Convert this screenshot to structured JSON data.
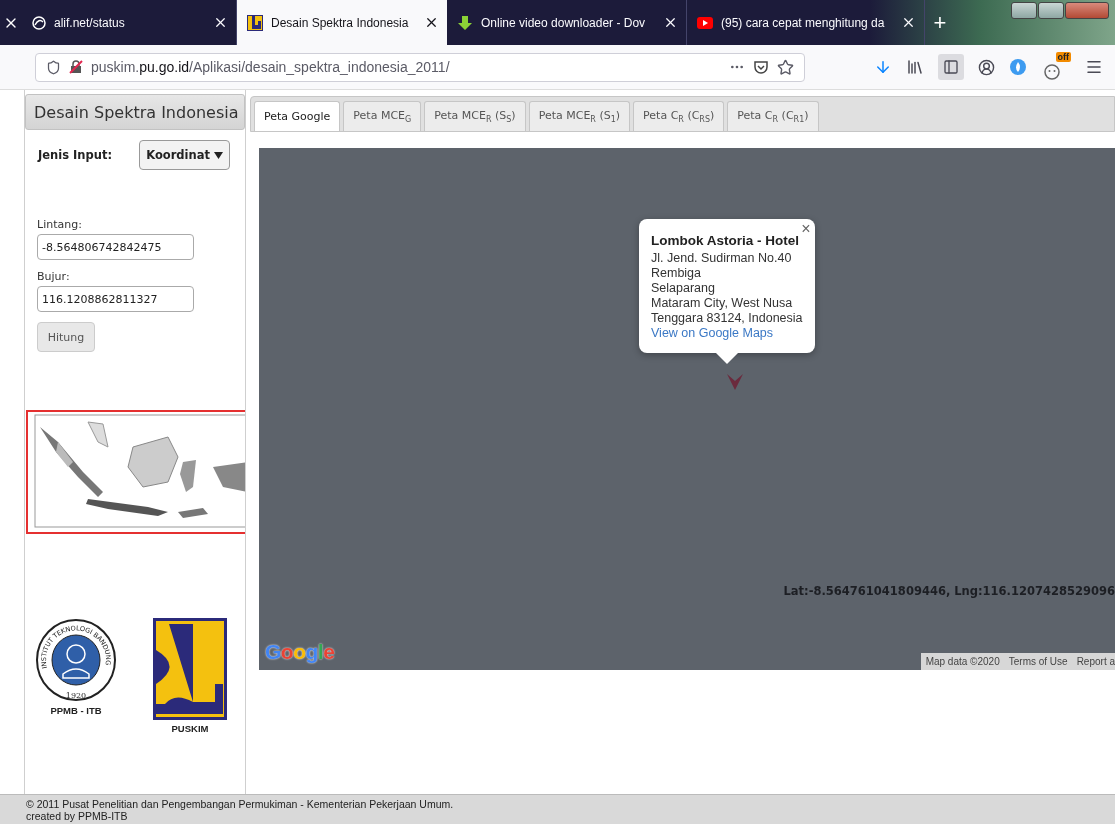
{
  "browser": {
    "tabs": [
      {
        "title": "alif.net/status",
        "kind": "status",
        "selected": false
      },
      {
        "title": "Desain Spektra Indonesia",
        "kind": "puskim",
        "selected": true
      },
      {
        "title": "Online video downloader - Dov",
        "kind": "download",
        "selected": false
      },
      {
        "title": "(95) cara cepat menghitung da",
        "kind": "youtube",
        "selected": false
      }
    ],
    "new_tab": "+",
    "url": "puskim.**pu.go.id**/Aplikasi/desain_spektra_indonesia_2011/",
    "addon_badge": "off"
  },
  "sidebar": {
    "title": "Desain Spektra Indonesia",
    "input_type": {
      "label": "Jenis Input:",
      "value": "Koordinat"
    },
    "fields": [
      {
        "label": "Lintang:",
        "value": "-8.564806742842475"
      },
      {
        "label": "Bujur:",
        "value": "116.1208862811327"
      }
    ],
    "button": "Hitung",
    "logos": [
      {
        "kind": "itb",
        "ring_text": "INSTITUT TEKNOLOGI BANDUNG",
        "year": "1920",
        "caption": "PPMB - ITB"
      },
      {
        "kind": "pu",
        "caption": "PUSKIM"
      }
    ]
  },
  "tabs": [
    {
      "label": "Peta Google",
      "selected": true
    },
    {
      "label": "Peta MCE$_{G}$",
      "selected": false
    },
    {
      "label": "Peta MCE$_{R}$ (S$_{S}$)",
      "selected": false
    },
    {
      "label": "Peta MCE$_{R}$ (S$_{1}$)",
      "selected": false
    },
    {
      "label": "Peta C$_{R}$ (C$_{RS}$)",
      "selected": false
    },
    {
      "label": "Peta C$_{R}$ (C$_{R1}$)",
      "selected": false
    }
  ],
  "map": {
    "popup": {
      "title": "Lombok Astoria - Hotel",
      "lines": [
        "Jl. Jend. Sudirman No.40",
        "Rembiga",
        "Selaparang",
        "Mataram City, West Nusa",
        "Tenggara 83124, Indonesia"
      ],
      "link": "View on Google Maps",
      "close": "×"
    },
    "coordinates": "Lat:-8.564761041809446, Lng:116.1207428529096",
    "logo": "Google",
    "attribution": [
      "Map data ©2020",
      "Terms of Use",
      "Report a"
    ]
  },
  "footer": [
    "© 2011 Pusat Penelitian dan Pengembangan Permukiman - Kementerian Pekerjaan Umum.",
    "created by PPMB-ITB"
  ]
}
